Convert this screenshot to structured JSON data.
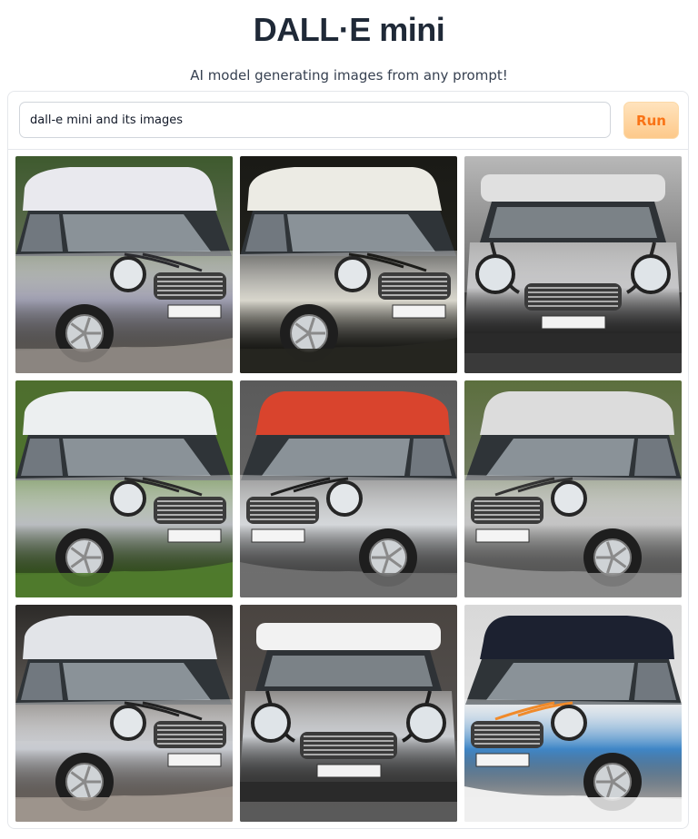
{
  "header": {
    "title": "DALL·E mini",
    "subtitle": "AI model generating images from any prompt!"
  },
  "prompt": {
    "value": "dall-e mini and its images",
    "placeholder": ""
  },
  "run_button": {
    "label": "Run"
  },
  "colors": {
    "accent": "#f97316",
    "run_bg_top": "#ffe3bd",
    "run_bg_bottom": "#fdc98a",
    "border": "#e5e7eb"
  },
  "gallery": {
    "images": [
      {
        "subject": "silver mini cooper",
        "body": "#9c9cae",
        "roof": "#e9e9ee",
        "stripe": "#2b2b2f",
        "bg": "#3e5a2e",
        "ground": "#8b8580",
        "angle": "left"
      },
      {
        "subject": "white mini cooper",
        "body": "#d8d6cc",
        "roof": "#ecebe4",
        "stripe": "#1d1d1a",
        "bg": "#1a1a16",
        "ground": "#262620",
        "angle": "left"
      },
      {
        "subject": "silver mini cooper front",
        "body": "#c6c6c8",
        "roof": "#e0e0e0",
        "stripe": "#262626",
        "bg": "#b8b8b8",
        "ground": "#3a3a3a",
        "angle": "front"
      },
      {
        "subject": "silver mini cooper on grass",
        "body": "#b9bcc0",
        "roof": "#eceff0",
        "stripe": "#2a2a2a",
        "bg": "#4e6e2e",
        "ground": "#4f7a2d",
        "angle": "left"
      },
      {
        "subject": "silver mini cooper red roof",
        "body": "#d4d7da",
        "roof": "#d9442d",
        "stripe": "#1f1f1f",
        "bg": "#5a5a5a",
        "ground": "#6f6f6f",
        "angle": "right"
      },
      {
        "subject": "silver mini cooper by field",
        "body": "#c3c3c3",
        "roof": "#dcdcdc",
        "stripe": "#333333",
        "bg": "#5c6f3e",
        "ground": "#8a8a8a",
        "angle": "right"
      },
      {
        "subject": "silver mini cooper on pavers",
        "body": "#c7cad0",
        "roof": "#e2e4e8",
        "stripe": "#222222",
        "bg": "#2c2a28",
        "ground": "#9d948c",
        "angle": "left"
      },
      {
        "subject": "silver mini cooper street",
        "body": "#c9ccd0",
        "roof": "#f2f2f2",
        "stripe": "#1b1b1b",
        "bg": "#4a4440",
        "ground": "#5a5a5a",
        "angle": "front"
      },
      {
        "subject": "blue mini cooper model",
        "body": "#3f86c6",
        "roof": "#1c2130",
        "stripe": "#f08a2a",
        "bg": "#d8d8d8",
        "ground": "#eeeeee",
        "angle": "right"
      }
    ]
  }
}
